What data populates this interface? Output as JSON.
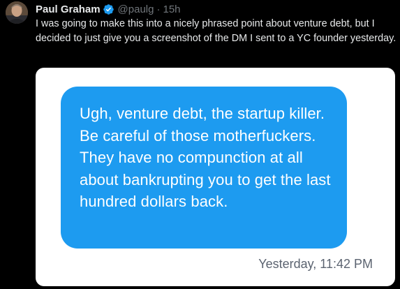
{
  "tweet": {
    "author_name": "Paul Graham",
    "handle": "@paulg",
    "separator": "·",
    "time": "15h",
    "verified_icon": "verified-badge-icon",
    "text": "I was going to make this into a nicely phrased point about venture debt, but I decided to just give you a screenshot of the DM I sent to a YC founder yesterday."
  },
  "dm": {
    "message": "Ugh, venture debt, the startup killer. Be careful of those motherfuckers. They have no compunction at all about bankrupting you to get the last hundred dollars back.",
    "timestamp": "Yesterday, 11:42 PM"
  },
  "colors": {
    "background": "#000000",
    "primary_text": "#e7e9ea",
    "secondary_text": "#71767b",
    "verified_blue": "#1d9bf0",
    "bubble_blue": "#1d9bf0",
    "card_background": "#ffffff",
    "timestamp_gray": "#5b6370"
  }
}
